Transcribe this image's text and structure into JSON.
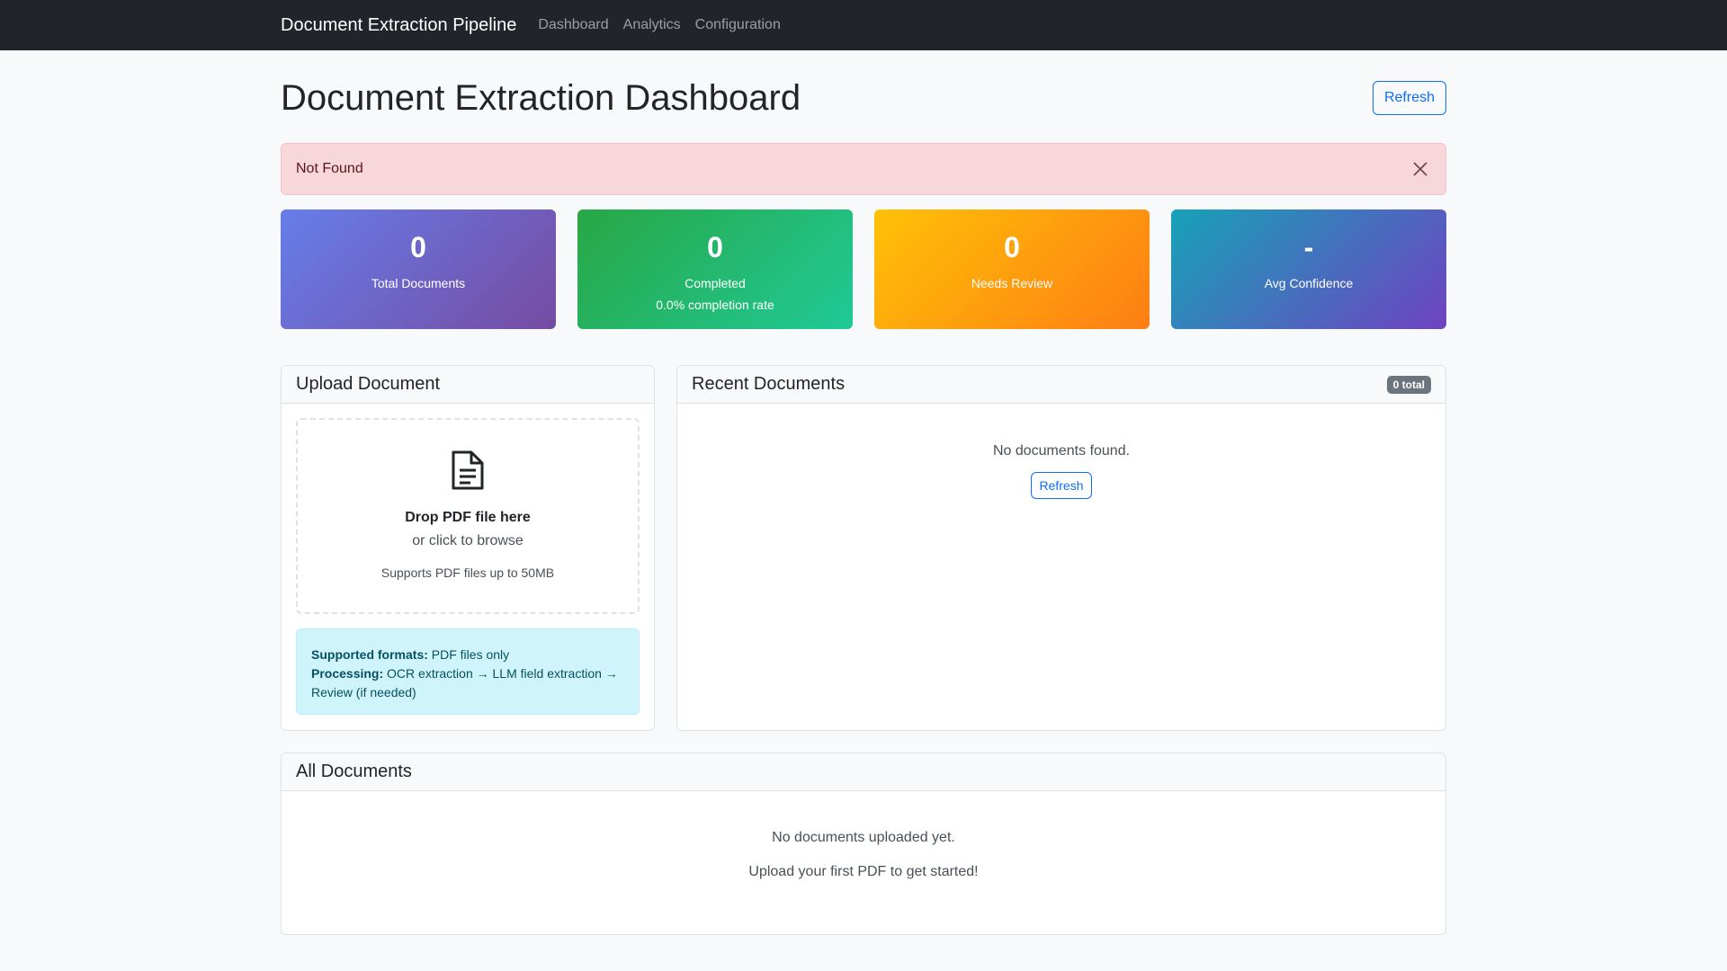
{
  "nav": {
    "brand": "Document Extraction Pipeline",
    "links": [
      "Dashboard",
      "Analytics",
      "Configuration"
    ]
  },
  "header": {
    "title": "Document Extraction Dashboard",
    "refresh_label": "Refresh"
  },
  "alert": {
    "message": "Not Found"
  },
  "stats": [
    {
      "value": "0",
      "label": "Total Documents"
    },
    {
      "value": "0",
      "label": "Completed",
      "sub": "0.0% completion rate"
    },
    {
      "value": "0",
      "label": "Needs Review"
    },
    {
      "value": "-",
      "label": "Avg Confidence"
    }
  ],
  "upload": {
    "title": "Upload Document",
    "icon": "file-text-icon",
    "drop_title": "Drop PDF file here",
    "drop_sub": "or click to browse",
    "drop_hint": "Supports PDF files up to 50MB",
    "formats_label": "Supported formats:",
    "formats_value": " PDF files only",
    "processing_label": "Processing:",
    "processing_value": " OCR extraction → LLM field extraction → Review (if needed)"
  },
  "recent": {
    "title": "Recent Documents",
    "badge": "0 total",
    "empty": "No documents found.",
    "refresh_label": "Refresh"
  },
  "all": {
    "title": "All Documents",
    "empty_line1": "No documents uploaded yet.",
    "empty_line2": "Upload your first PDF to get started!"
  }
}
